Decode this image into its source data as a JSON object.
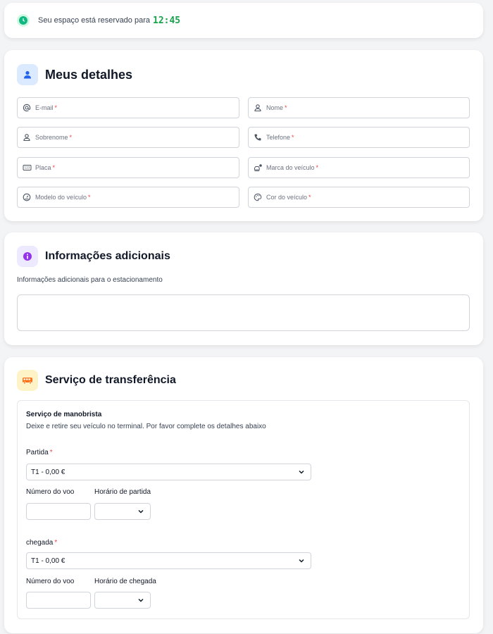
{
  "timer": {
    "text": "Seu espaço está reservado para",
    "value": "12:45"
  },
  "details": {
    "title": "Meus detalhes",
    "fields": [
      {
        "label": "E-mail",
        "icon": "at-icon"
      },
      {
        "label": "Nome",
        "icon": "user-icon"
      },
      {
        "label": "Sobrenome",
        "icon": "user-icon"
      },
      {
        "label": "Telefone",
        "icon": "phone-icon"
      },
      {
        "label": "Placa",
        "icon": "license-plate-icon"
      },
      {
        "label": "Marca do veículo",
        "icon": "car-brand-icon"
      },
      {
        "label": "Modelo do veículo",
        "icon": "gauge-icon"
      },
      {
        "label": "Cor do veículo",
        "icon": "palette-icon"
      }
    ],
    "required_mark": "*"
  },
  "info": {
    "title": "Informações adicionais",
    "description": "Informações adicionais para o estacionamento"
  },
  "transfer": {
    "title": "Serviço de transferência",
    "valet_title": "Serviço de manobrista",
    "valet_desc": "Deixe e retire seu veículo no terminal. Por favor complete os detalhes abaixo",
    "departure": {
      "label": "Partida",
      "selected": "T1 - 0,00 €",
      "flight_label": "Número do voo",
      "time_label": "Horário de partida"
    },
    "arrival": {
      "label": "chegada",
      "selected": "T1 - 0,00 €",
      "flight_label": "Número do voo",
      "time_label": "Horário de chegada"
    }
  },
  "colors": {
    "accent_green": "#16a34a",
    "details_icon_bg": "#dbeafe",
    "info_icon_bg": "#ede9fe",
    "transfer_icon_bg": "#fef3c7",
    "required": "#ef4444"
  }
}
